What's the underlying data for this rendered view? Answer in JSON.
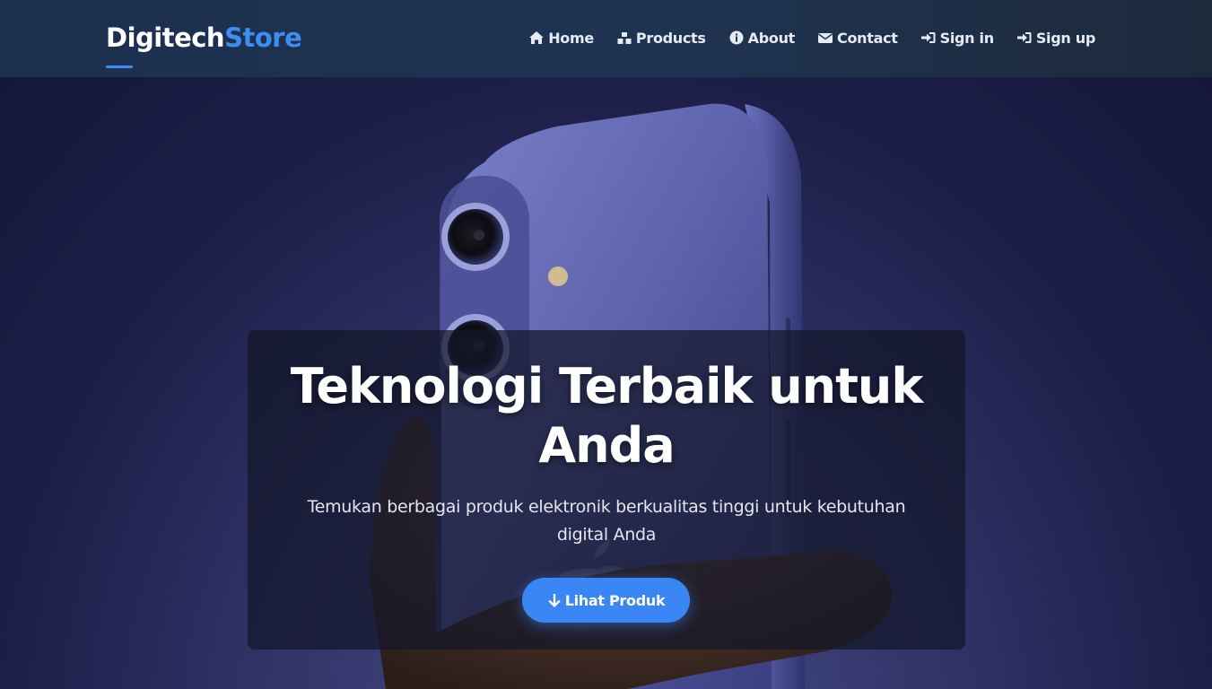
{
  "navbar": {
    "brand_part1": "Digitech",
    "brand_part2": "Store",
    "items": [
      {
        "label": "Home",
        "icon": "home-icon"
      },
      {
        "label": "Products",
        "icon": "boxes-icon"
      },
      {
        "label": "About",
        "icon": "info-icon"
      },
      {
        "label": "Contact",
        "icon": "envelope-icon"
      },
      {
        "label": "Sign in",
        "icon": "sign-in-icon"
      },
      {
        "label": "Sign up",
        "icon": "sign-in-icon"
      }
    ]
  },
  "hero": {
    "title_line1": "Teknologi Terbaik untuk",
    "title_line2": "Anda",
    "subtitle_line1": "Temukan berbagai produk elektronik berkualitas tinggi untuk kebutuhan",
    "subtitle_line2": "digital Anda",
    "cta_label": "Lihat Produk",
    "cta_icon": "arrow-down-icon"
  },
  "colors": {
    "accent": "#3b86f5",
    "brand_accent": "#3d8ef0",
    "navbar_bg": "#1f3352"
  }
}
